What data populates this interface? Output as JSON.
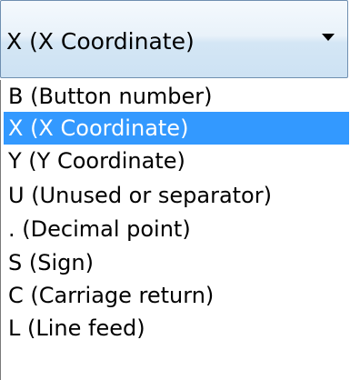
{
  "combo": {
    "selected_value": "X (X Coordinate)",
    "arrow_icon": "chevron-down-icon"
  },
  "options": [
    {
      "label": "B (Button number)",
      "selected": false
    },
    {
      "label": "X (X Coordinate)",
      "selected": true
    },
    {
      "label": "Y (Y Coordinate)",
      "selected": false
    },
    {
      "label": "U (Unused or separator)",
      "selected": false
    },
    {
      "label": ". (Decimal point)",
      "selected": false
    },
    {
      "label": "S (Sign)",
      "selected": false
    },
    {
      "label": "C (Carriage return)",
      "selected": false
    },
    {
      "label": "L (Line feed)",
      "selected": false
    }
  ],
  "colors": {
    "selection": "#3399ff",
    "selection_text": "#ffffff"
  }
}
